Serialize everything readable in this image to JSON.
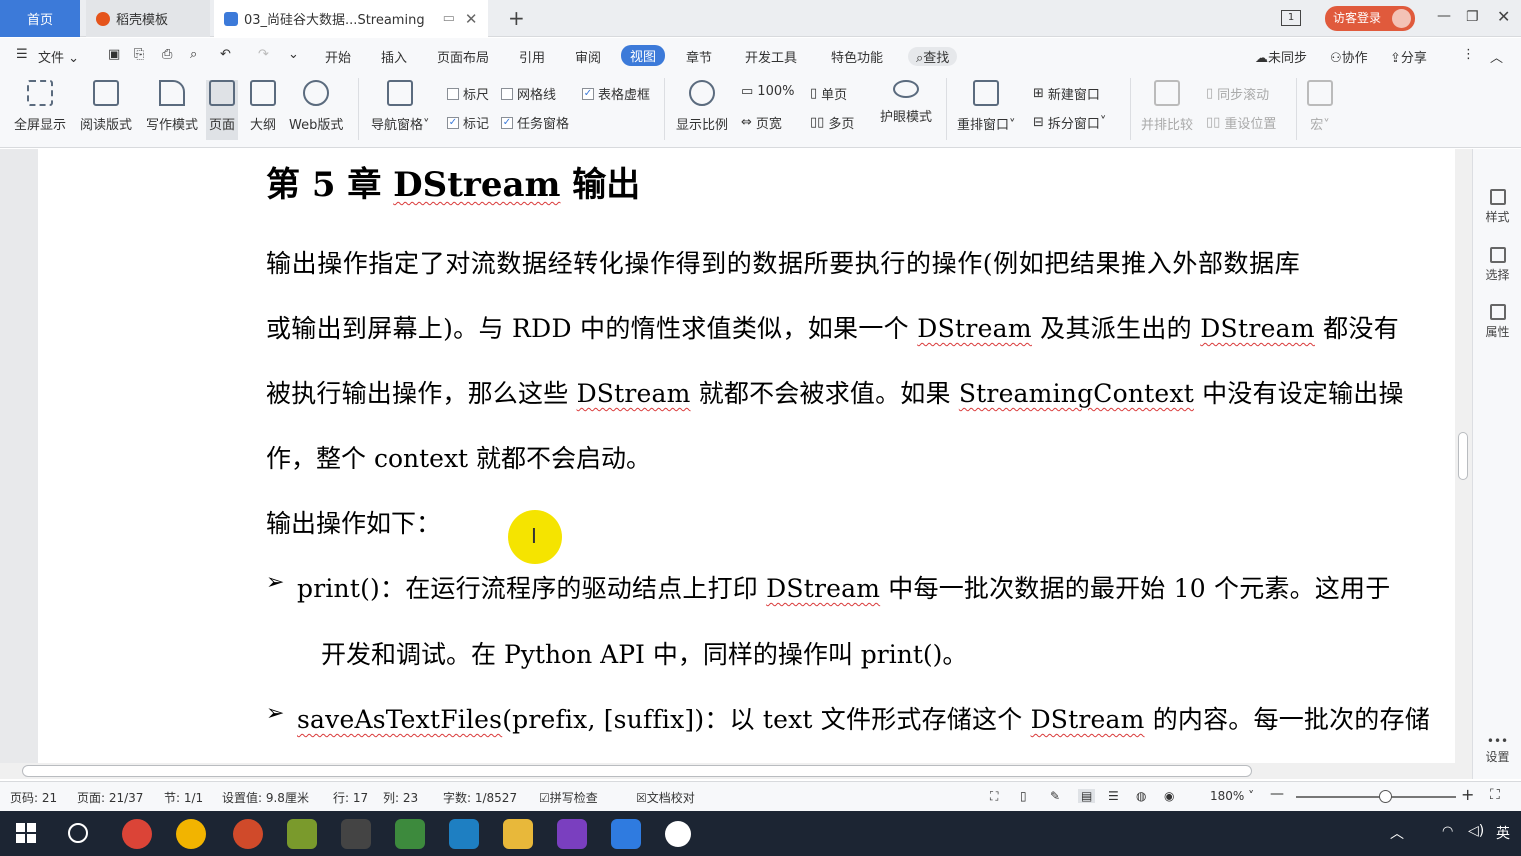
{
  "titlebar": {
    "tab_home": "首页",
    "tab_template": "稻壳模板",
    "tab_doc": "03_尚硅谷大数据...Streaming",
    "new_tab": "+",
    "page_badge": "1",
    "login": "访客登录"
  },
  "menu": {
    "file": "文件",
    "tabs": [
      "开始",
      "插入",
      "页面布局",
      "引用",
      "审阅",
      "视图",
      "章节",
      "开发工具",
      "特色功能"
    ],
    "find": "查找",
    "sync": "未同步",
    "collab": "协作",
    "share": "分享"
  },
  "toolbar": {
    "fullscreen": "全屏显示",
    "read": "阅读版式",
    "write": "写作模式",
    "page": "页面",
    "outline": "大纲",
    "web": "Web版式",
    "navpane": "导航窗格",
    "ruler": "标尺",
    "gridline": "网格线",
    "tableframe": "表格虚框",
    "mark": "标记",
    "taskpane": "任务窗格",
    "zoom": "显示比例",
    "zoom_value": "100%",
    "pagewidth": "页宽",
    "single": "单页",
    "multi": "多页",
    "eye": "护眼模式",
    "rearrange": "重排窗口",
    "newwin": "新建窗口",
    "splitwin": "拆分窗口",
    "sidebyside": "并排比较",
    "syncscroll": "同步滚动",
    "resetpos": "重设位置",
    "macro": "宏"
  },
  "rightpanel": {
    "style": "样式",
    "select": "选择",
    "props": "属性",
    "settings": "设置"
  },
  "doc": {
    "heading_a": "第 5 章  ",
    "heading_b": "DStream",
    "heading_c": " 输出",
    "l1": "    输出操作指定了对流数据经转化操作得到的数据所要执行的操作(例如把结果推入外部数据库",
    "l2a": "或输出到屏幕上)。与 RDD 中的惰性求值类似，如果一个 ",
    "l2b": "DStream",
    "l2c": " 及其派生出的 ",
    "l2d": "DStream",
    "l2e": " 都没有",
    "l3a": "被执行输出操作，那么这些 ",
    "l3b": "DStream",
    "l3c": " 就都不会被求值。如果 ",
    "l3d": "StreamingContext",
    "l3e": " 中没有设定输出操",
    "l4": "作，整个 context 就都不会启动。",
    "l5": "输出操作如下：",
    "bullet": "➢",
    "b1a": "print()：在运行流程序的驱动结点上打印 ",
    "b1b": "DStream",
    "b1c": " 中每一批次数据的最开始 10 个元素。这用于",
    "b1d": "开发和调试。在 Python API 中，同样的操作叫 print()。",
    "b2a": "saveAsTextFiles",
    "b2b": "(prefix, [suffix])：以 text 文件形式存储这个 ",
    "b2c": "DStream",
    "b2d": " 的内容。每一批次的存储"
  },
  "status": {
    "pageno": "页码: 21",
    "pages": "页面: 21/37",
    "section": "节: 1/1",
    "setting": "设置值: 9.8厘米",
    "row": "行: 17",
    "col": "列: 23",
    "words": "字数: 1/8527",
    "spell": "拼写检查",
    "proof": "文档校对",
    "zoom": "180%"
  },
  "taskbar": {
    "ime": "英"
  }
}
